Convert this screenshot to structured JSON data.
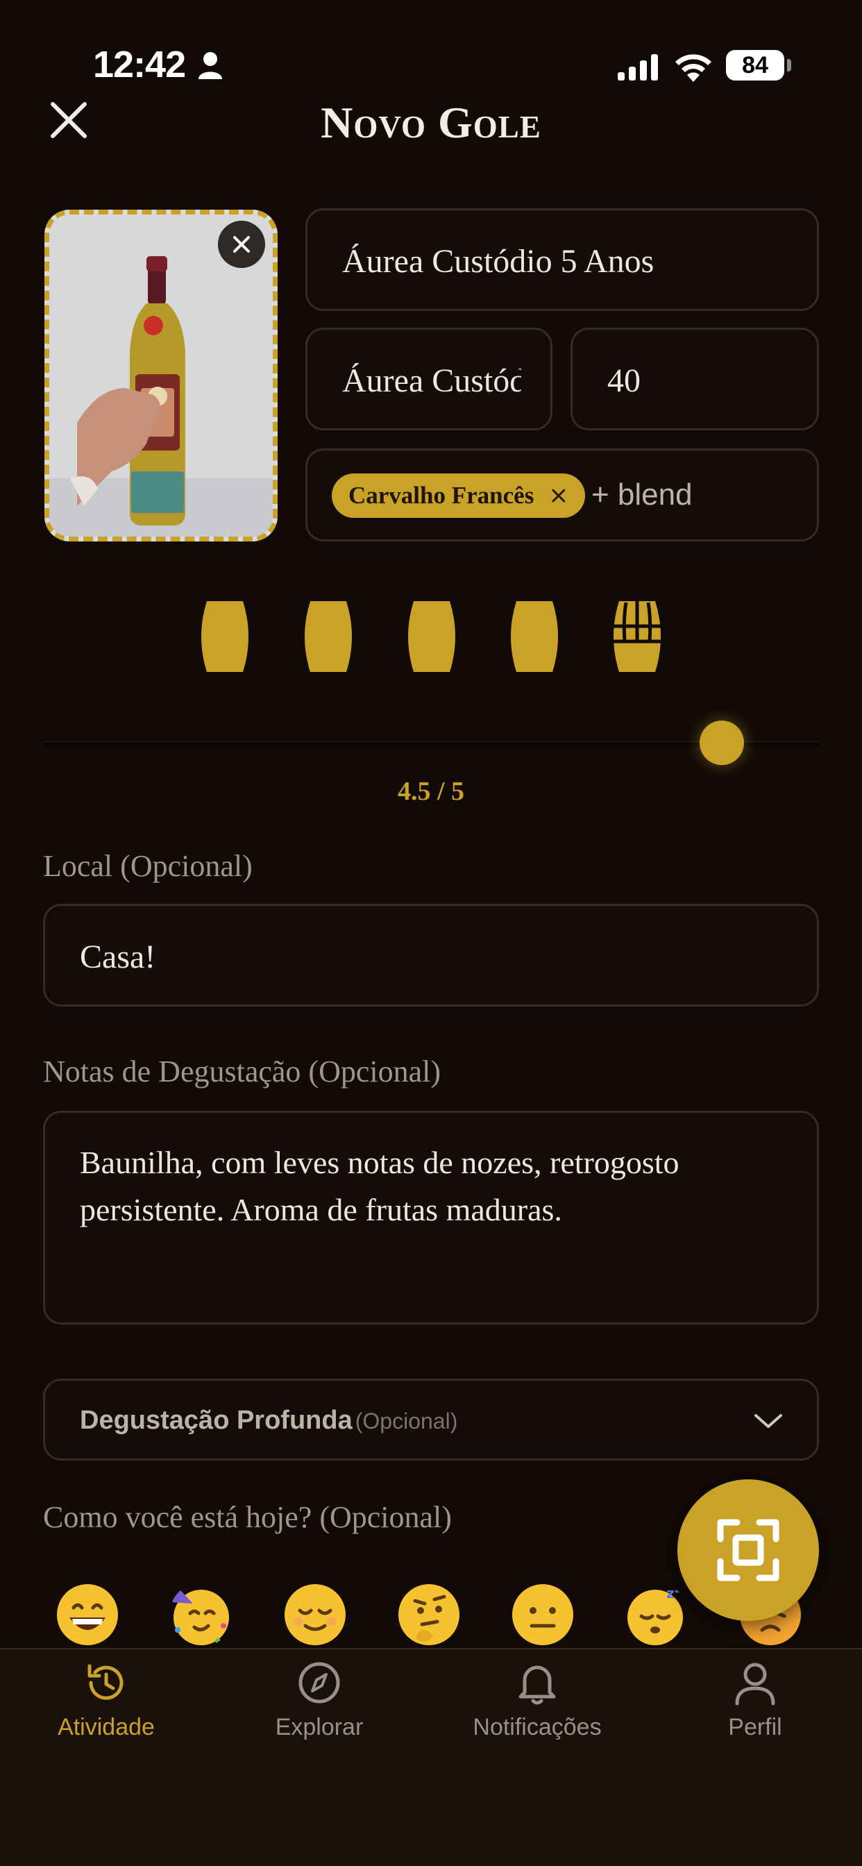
{
  "status_bar": {
    "time": "12:42",
    "battery": "84"
  },
  "header": {
    "title": "Novo Gole"
  },
  "form": {
    "name_value": "Áurea Custódio 5 Anos",
    "producer_value": "Áurea Custódio",
    "abv_value": "40",
    "wood_chip": "Carvalho Francês",
    "add_blend": "+ blend",
    "rating_text": "4.5 / 5",
    "rating_value": 4.5,
    "rating_max": 5,
    "local_label": "Local (Opcional)",
    "local_value": "Casa!",
    "notes_label": "Notas de Degustação (Opcional)",
    "notes_value": "Baunilha, com leves notas de nozes, retrogosto persistente. Aroma de frutas maduras.",
    "deep_title": "Degustação Profunda",
    "deep_optional": "(Opcional)",
    "mood_label": "Como você está hoje? (Opcional)"
  },
  "moods": [
    {
      "icon": "grinning-face-icon"
    },
    {
      "icon": "partying-face-icon"
    },
    {
      "icon": "relieved-face-icon"
    },
    {
      "icon": "thinking-face-icon"
    },
    {
      "icon": "neutral-face-icon"
    },
    {
      "icon": "sleeping-face-icon"
    },
    {
      "icon": "persevering-face-icon"
    }
  ],
  "tabbar": {
    "items": [
      {
        "label": "Atividade",
        "icon": "history-icon",
        "active": true
      },
      {
        "label": "Explorar",
        "icon": "compass-icon",
        "active": false
      },
      {
        "label": "Notificações",
        "icon": "bell-icon",
        "active": false
      },
      {
        "label": "Perfil",
        "icon": "person-icon",
        "active": false
      }
    ]
  },
  "colors": {
    "accent": "#c9a227",
    "background": "#120a07",
    "border": "#3a2a20"
  }
}
